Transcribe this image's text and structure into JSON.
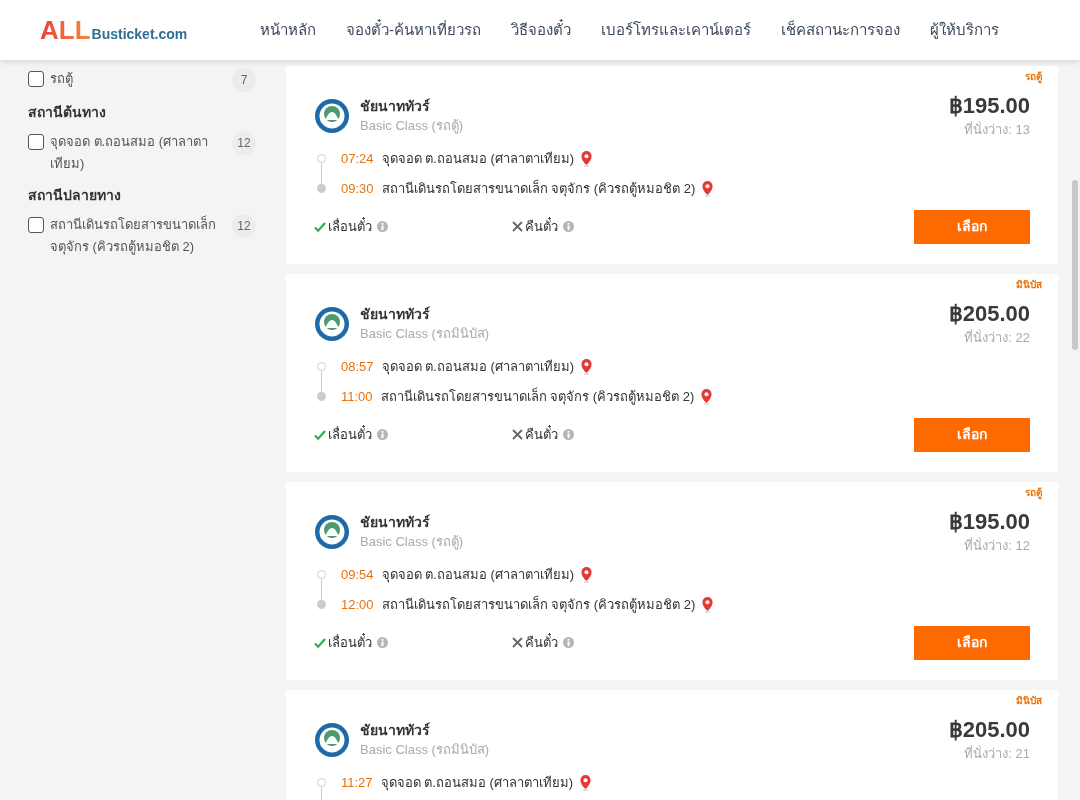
{
  "header": {
    "logo": {
      "primary": "ALL",
      "secondary": "Busticket.com"
    },
    "nav": [
      "หน้าหลัก",
      "จองตั๋ว-ค้นหาเที่ยวรถ",
      "วิธีจองตั๋ว",
      "เบอร์โทรและเคาน์เตอร์",
      "เช็คสถานะการจอง",
      "ผู้ให้บริการ"
    ]
  },
  "sidebar": {
    "sections": [
      {
        "options": [
          {
            "label": "รถตู้",
            "count": "7",
            "checked": false
          }
        ]
      },
      {
        "title": "สถานีต้นทาง",
        "options": [
          {
            "label": "จุดจอด ต.ถอนสมอ (ศาลาตาเทียม)",
            "count": "12",
            "checked": false
          }
        ]
      },
      {
        "title": "สถานีปลายทาง",
        "options": [
          {
            "label": "สถานีเดินรถโดยสารขนาดเล็ก จตุจักร (คิวรถตู้หมอชิต 2)",
            "count": "12",
            "checked": false
          }
        ]
      }
    ]
  },
  "trips": [
    {
      "vehicle_tag": "รถตู้",
      "operator": "ชัยนาททัวร์",
      "class": "Basic Class (รถตู้)",
      "price": "฿195.00",
      "seats": "ที่นั่งว่าง: 13",
      "stops": [
        {
          "kind": "departure",
          "time": "07:24",
          "place": "จุดจอด ต.ถอนสมอ (ศาลาตาเทียม)"
        },
        {
          "kind": "arrival",
          "time": "09:30",
          "place": "สถานีเดินรถโดยสารขนาดเล็ก จตุจักร (คิวรถตู้หมอชิต 2)"
        }
      ],
      "policies": [
        {
          "label": "เลื่อนตั๋ว",
          "available": true
        },
        {
          "label": "คืนตั๋ว",
          "available": false
        }
      ],
      "button": "เลือก"
    },
    {
      "vehicle_tag": "มินิบัส",
      "operator": "ชัยนาททัวร์",
      "class": "Basic Class (รถมินิบัส)",
      "price": "฿205.00",
      "seats": "ที่นั่งว่าง: 22",
      "stops": [
        {
          "kind": "departure",
          "time": "08:57",
          "place": "จุดจอด ต.ถอนสมอ (ศาลาตาเทียม)"
        },
        {
          "kind": "arrival",
          "time": "11:00",
          "place": "สถานีเดินรถโดยสารขนาดเล็ก จตุจักร (คิวรถตู้หมอชิต 2)"
        }
      ],
      "policies": [
        {
          "label": "เลื่อนตั๋ว",
          "available": true
        },
        {
          "label": "คืนตั๋ว",
          "available": false
        }
      ],
      "button": "เลือก"
    },
    {
      "vehicle_tag": "รถตู้",
      "operator": "ชัยนาททัวร์",
      "class": "Basic Class (รถตู้)",
      "price": "฿195.00",
      "seats": "ที่นั่งว่าง: 12",
      "stops": [
        {
          "kind": "departure",
          "time": "09:54",
          "place": "จุดจอด ต.ถอนสมอ (ศาลาตาเทียม)"
        },
        {
          "kind": "arrival",
          "time": "12:00",
          "place": "สถานีเดินรถโดยสารขนาดเล็ก จตุจักร (คิวรถตู้หมอชิต 2)"
        }
      ],
      "policies": [
        {
          "label": "เลื่อนตั๋ว",
          "available": true
        },
        {
          "label": "คืนตั๋ว",
          "available": false
        }
      ],
      "button": "เลือก"
    },
    {
      "vehicle_tag": "มินิบัส",
      "operator": "ชัยนาททัวร์",
      "class": "Basic Class (รถมินิบัส)",
      "price": "฿205.00",
      "seats": "ที่นั่งว่าง: 21",
      "stops": [
        {
          "kind": "departure",
          "time": "11:27",
          "place": "จุดจอด ต.ถอนสมอ (ศาลาตาเทียม)"
        }
      ]
    }
  ]
}
